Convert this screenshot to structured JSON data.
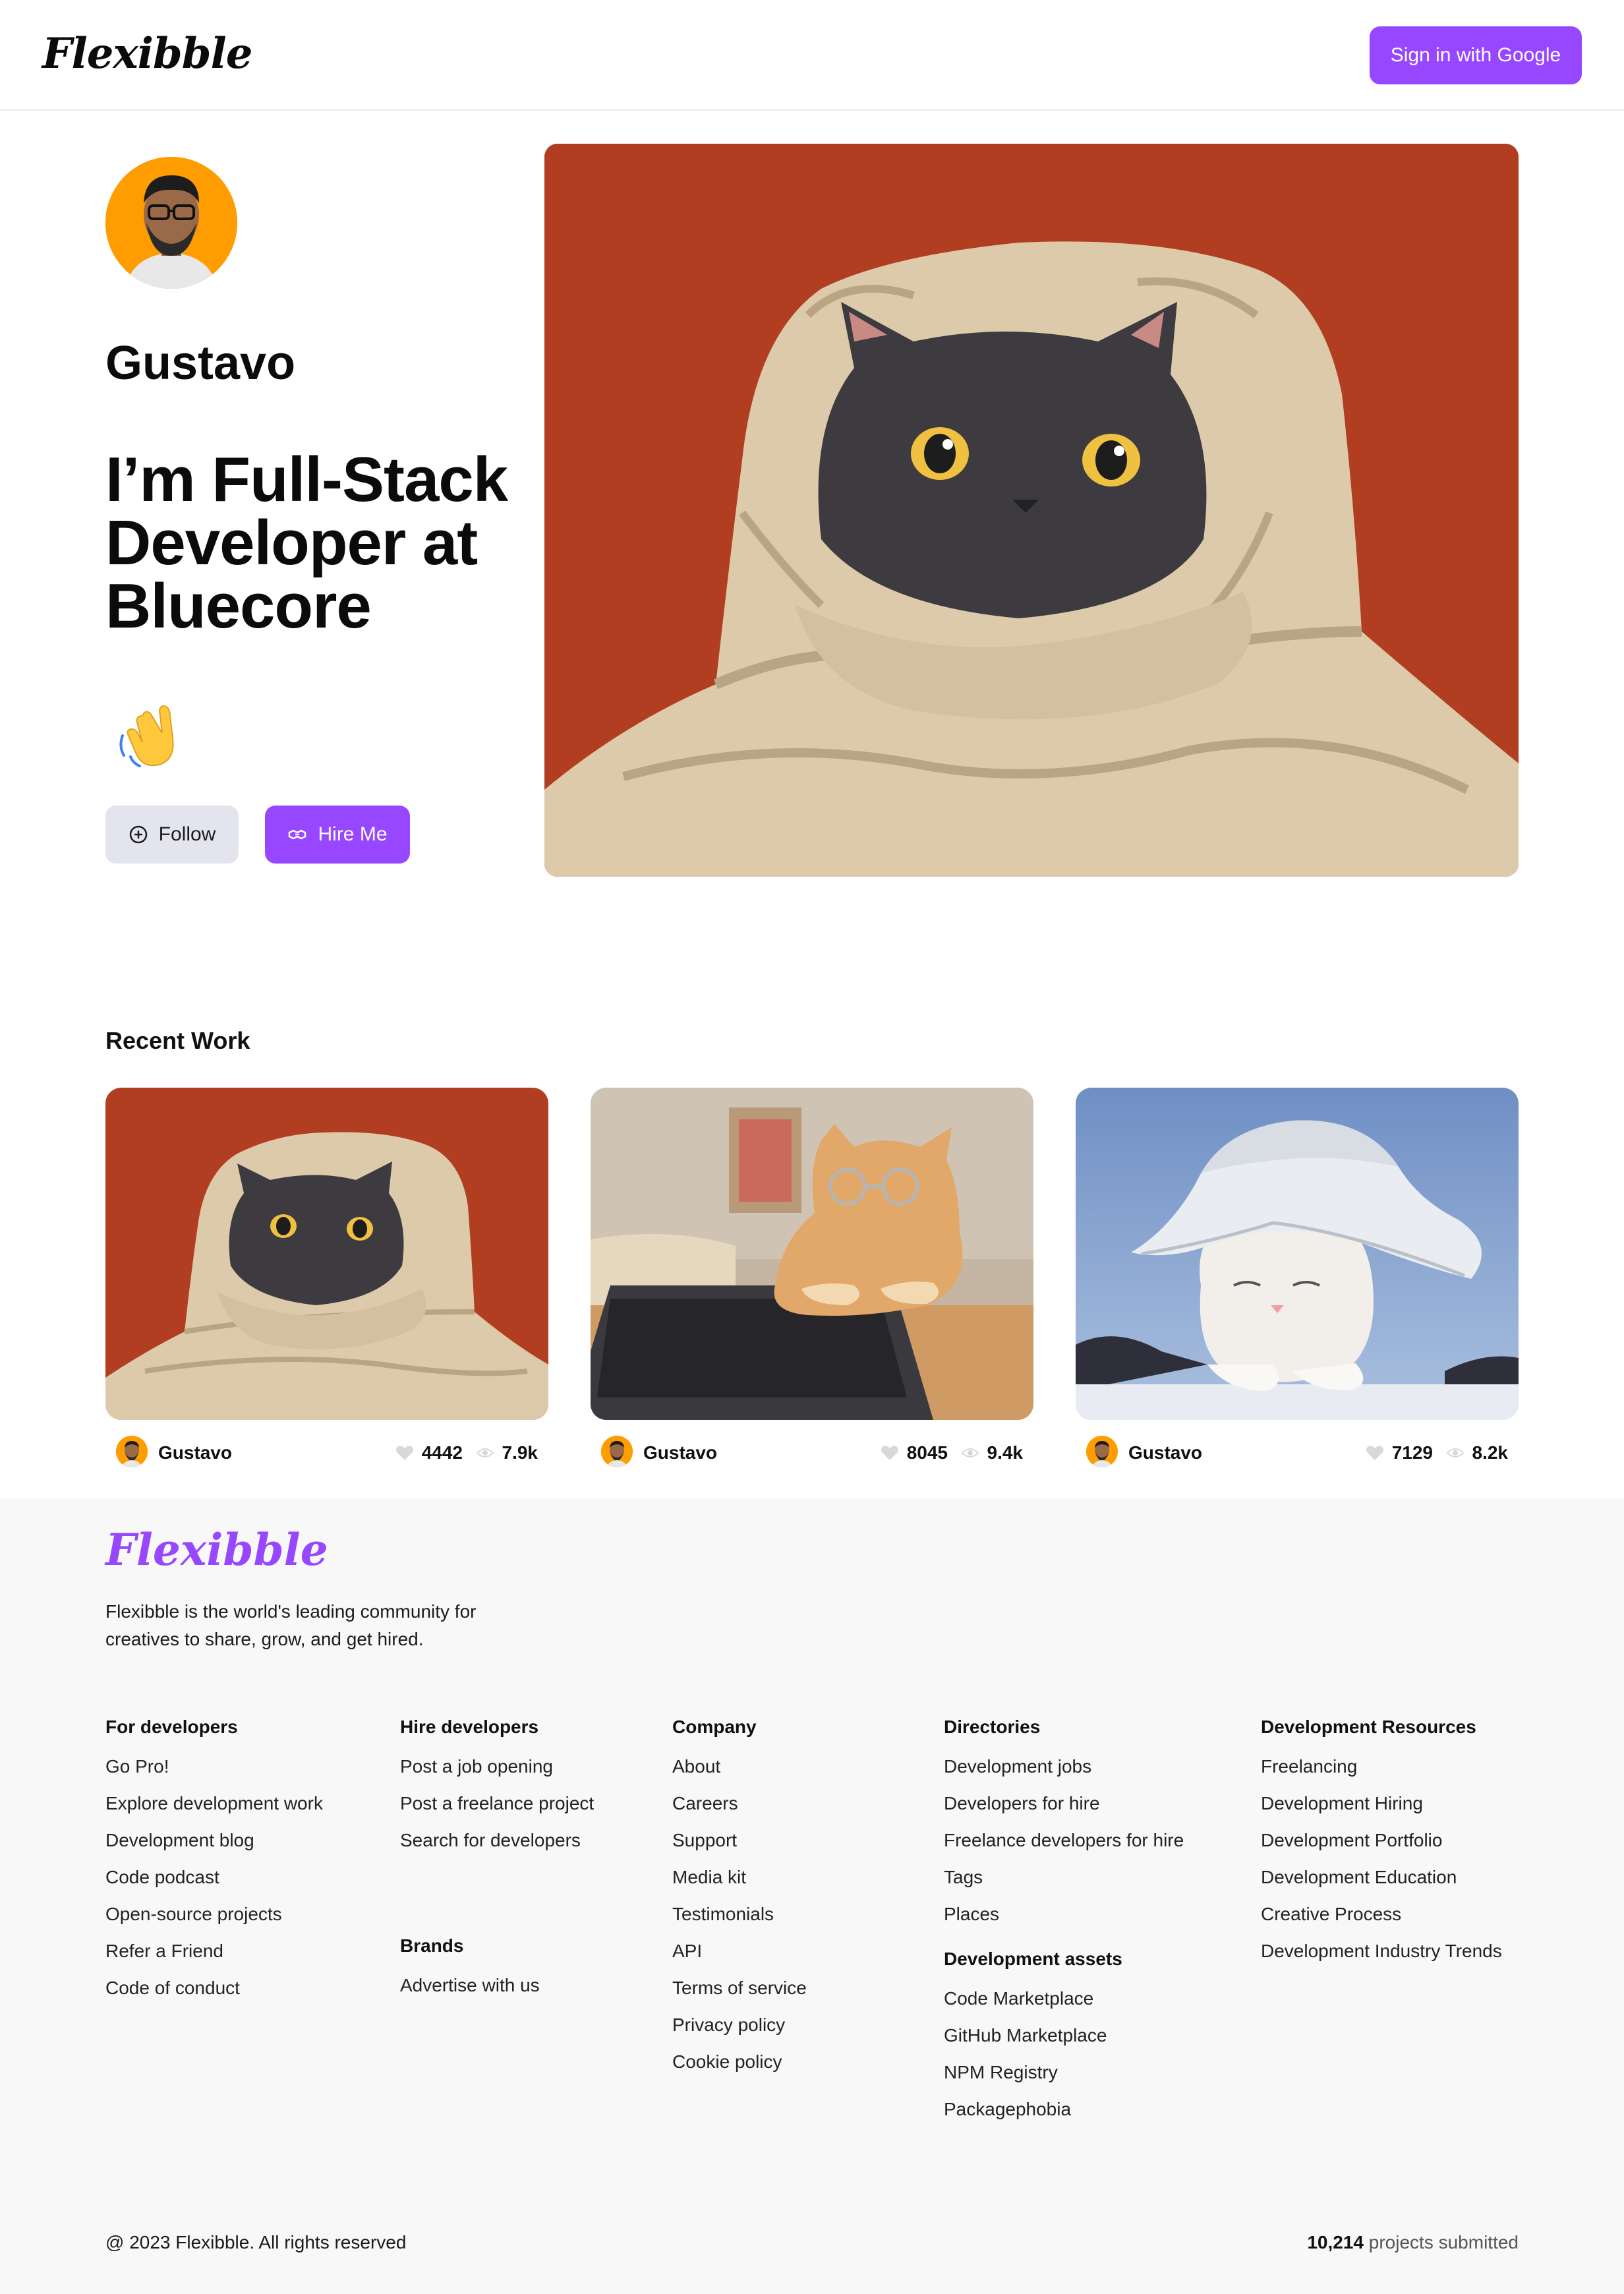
{
  "nav": {
    "logo": "Flexibble",
    "signin_label": "Sign in with Google"
  },
  "profile": {
    "name": "Gustavo",
    "headline": "I’m Full-Stack Developer at Bluecore",
    "follow_label": "Follow",
    "hire_label": "Hire Me"
  },
  "recent": {
    "title": "Recent Work",
    "cards": [
      {
        "author": "Gustavo",
        "likes": "4442",
        "views": "7.9k"
      },
      {
        "author": "Gustavo",
        "likes": "8045",
        "views": "9.4k"
      },
      {
        "author": "Gustavo",
        "likes": "7129",
        "views": "8.2k"
      }
    ]
  },
  "footer": {
    "logo": "Flexibble",
    "description": "Flexibble is the world's leading community for creatives to share, grow, and get hired.",
    "columns": {
      "for_developers": {
        "title": "For developers",
        "links": [
          "Go Pro!",
          "Explore development work",
          "Development blog",
          "Code podcast",
          "Open-source projects",
          "Refer a Friend",
          "Code of conduct"
        ]
      },
      "hire_developers": {
        "title": "Hire developers",
        "links": [
          "Post a job opening",
          "Post a freelance project",
          "Search for developers"
        ]
      },
      "brands": {
        "title": "Brands",
        "links": [
          "Advertise with us"
        ]
      },
      "company": {
        "title": "Company",
        "links": [
          "About",
          "Careers",
          "Support",
          "Media kit",
          "Testimonials",
          "API",
          "Terms of service",
          "Privacy policy",
          "Cookie policy"
        ]
      },
      "directories": {
        "title": "Directories",
        "links": [
          "Development jobs",
          "Developers for hire",
          "Freelance developers for hire",
          "Tags",
          "Places"
        ]
      },
      "development_assets": {
        "title": "Development assets",
        "links": [
          "Code Marketplace",
          "GitHub Marketplace",
          "NPM Registry",
          "Packagephobia"
        ]
      },
      "development_resources": {
        "title": "Development Resources",
        "links": [
          "Freelancing",
          "Development Hiring",
          "Development Portfolio",
          "Development Education",
          "Creative Process",
          "Development Industry Trends"
        ]
      }
    },
    "copyright": "@ 2023 Flexibble. All rights reserved",
    "projects_count": "10,214",
    "projects_suffix": "projects submitted"
  },
  "colors": {
    "accent": "#9747ff",
    "secondary_button": "#e4e4ee",
    "avatar_bg": "#ff9d00",
    "footer_bg": "#f8f8f8"
  }
}
